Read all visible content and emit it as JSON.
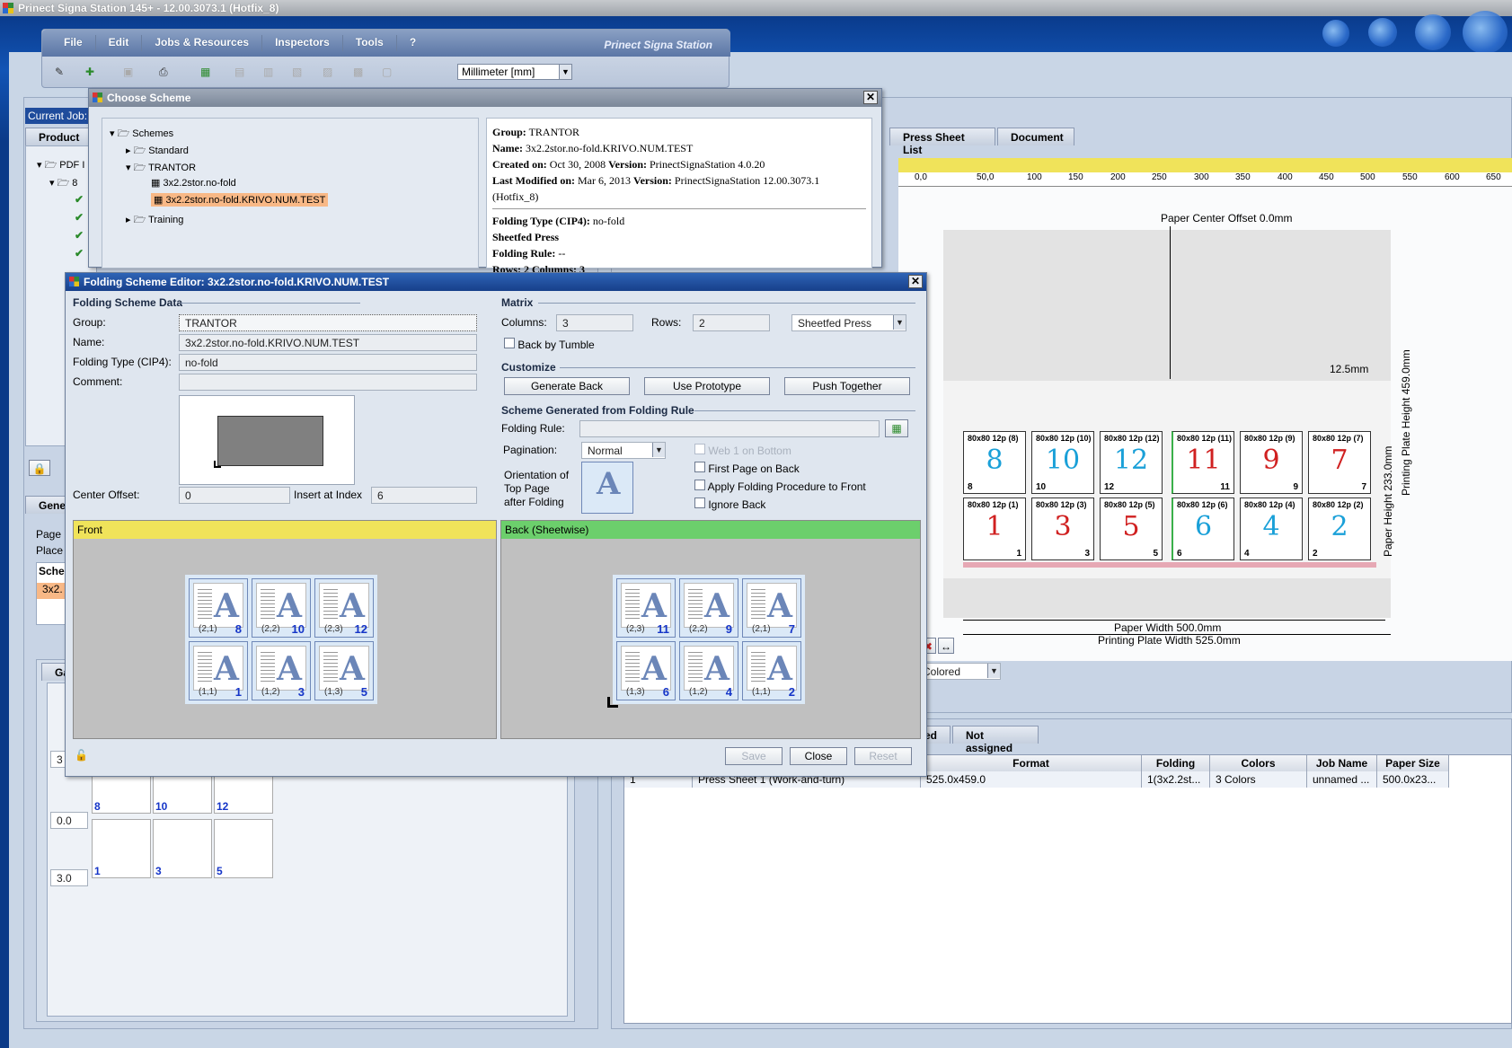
{
  "app": {
    "title": "Prinect Signa Station 145+  -  12.00.3073.1 (Hotfix_8)",
    "brand": "Prinect Signa Station"
  },
  "menu": [
    "File",
    "Edit",
    "Jobs & Resources",
    "Inspectors",
    "Tools",
    "?"
  ],
  "toolbar": {
    "unit": "Millimeter  [mm]"
  },
  "background": {
    "current_job_label": "Current Job:",
    "product_tab": "Product P",
    "pdf_node": "PDF I",
    "node_8": "8",
    "gene_tab": "Gene",
    "page_label": "Page",
    "place_label": "Place",
    "sche_header": "Sche",
    "sche_value": "3x2.",
    "ga_tab": "Ga",
    "val_3": "3",
    "val_00": "0.0",
    "val_30": "3.0",
    "thumb_nums": [
      "8",
      "10",
      "12",
      "1",
      "3",
      "5"
    ]
  },
  "right_area": {
    "tabs": [
      "Press Sheet List",
      "Document"
    ],
    "ruler_ticks": [
      "0,0",
      "50,0",
      "100",
      "150",
      "200",
      "250",
      "300",
      "350",
      "400",
      "450",
      "500",
      "550",
      "600",
      "650"
    ],
    "paper_center_offset": "Paper Center Offset 0.0mm",
    "margin_label": "12.5mm",
    "paper_height": "Paper Height 233.0mm",
    "plate_height": "Printing Plate Height 459.0mm",
    "paper_width": "Paper Width 500.0mm",
    "plate_width": "Printing Plate Width 525.0mm",
    "colors_select": "Colored",
    "sheet_cells": [
      {
        "hd": "80x80 12p (8)",
        "big": "8",
        "sm": "8",
        "color": "#1aa0d8"
      },
      {
        "hd": "80x80 12p (10)",
        "big": "10",
        "sm": "10",
        "color": "#1aa0d8"
      },
      {
        "hd": "80x80 12p (12)",
        "big": "12",
        "sm": "12",
        "color": "#1aa0d8"
      },
      {
        "hd": "80x80 12p (11)",
        "big": "11",
        "sm": "11",
        "color": "#d02020"
      },
      {
        "hd": "80x80 12p (9)",
        "big": "9",
        "sm": "9",
        "color": "#d02020"
      },
      {
        "hd": "80x80 12p (7)",
        "big": "7",
        "sm": "7",
        "color": "#d02020"
      },
      {
        "hd": "80x80 12p (1)",
        "big": "1",
        "sm": "1",
        "color": "#d02020"
      },
      {
        "hd": "80x80 12p (3)",
        "big": "3",
        "sm": "3",
        "color": "#d02020"
      },
      {
        "hd": "80x80 12p (5)",
        "big": "5",
        "sm": "5",
        "color": "#d02020"
      },
      {
        "hd": "80x80 12p (6)",
        "big": "6",
        "sm": "6",
        "color": "#1aa0d8"
      },
      {
        "hd": "80x80 12p (4)",
        "big": "4",
        "sm": "4",
        "color": "#1aa0d8"
      },
      {
        "hd": "80x80 12p (2)",
        "big": "2",
        "sm": "2",
        "color": "#1aa0d8"
      }
    ],
    "lower_tabs": [
      "ed",
      "Not assigned"
    ],
    "table": {
      "headers": [
        "Format",
        "Folding Sheet",
        "Colors",
        "Job Name",
        "Paper Size"
      ],
      "row": {
        "index": "1",
        "name": "Press Sheet 1 (Work-and-turn)",
        "format": "525.0x459.0",
        "folding": "1(3x2.2st...",
        "colors": "3 Colors",
        "job": "unnamed ...",
        "paper": "500.0x23..."
      }
    }
  },
  "choose_scheme": {
    "title": "Choose Scheme",
    "tree": {
      "root": "Schemes",
      "standard": "Standard",
      "tranto": "TRANTOR",
      "item1": "3x2.2stor.no-fold",
      "item2": "3x2.2stor.no-fold.KRIVO.NUM.TEST",
      "training": "Training"
    },
    "info": {
      "group_k": "Group:",
      "group_v": "TRANTOR",
      "name_k": "Name:",
      "name_v": "3x2.2stor.no-fold.KRIVO.NUM.TEST",
      "created_k": "Created on:",
      "created_v": "Oct 30, 2008",
      "version_k": "Version:",
      "version_v": "PrinectSignaStation 4.0.20",
      "modified_k": "Last Modified on:",
      "modified_v": "Mar 6, 2013",
      "version2_v": "PrinectSignaStation 12.00.3073.1 (Hotfix_8)",
      "ftype_k": "Folding Type (CIP4):",
      "ftype_v": "no-fold",
      "sheetfed": "Sheetfed Press",
      "frule_k": "Folding Rule:",
      "frule_v": "--",
      "rows": "Rows: 2  Columns: 3"
    }
  },
  "editor": {
    "title": "Folding Scheme Editor: 3x2.2stor.no-fold.KRIVO.NUM.TEST",
    "data_section": "Folding Scheme Data",
    "group_label": "Group:",
    "group_value": "TRANTOR",
    "name_label": "Name:",
    "name_value": "3x2.2stor.no-fold.KRIVO.NUM.TEST",
    "ftype_label": "Folding Type (CIP4):",
    "ftype_value": "no-fold",
    "comment_label": "Comment:",
    "comment_value": "",
    "center_offset_label": "Center Offset:",
    "center_offset_value": "0",
    "insert_index_label": "Insert at Index",
    "insert_index_value": "6",
    "matrix_section": "Matrix",
    "columns_label": "Columns:",
    "columns_value": "3",
    "rows_label": "Rows:",
    "rows_value": "2",
    "press_type": "Sheetfed Press",
    "back_by_tumble": "Back by Tumble",
    "customize_section": "Customize",
    "generate_back": "Generate Back",
    "use_prototype": "Use Prototype",
    "push_together": "Push Together",
    "generated_section": "Scheme Generated from Folding Rule",
    "folding_rule_label": "Folding Rule:",
    "pagination_label": "Pagination:",
    "pagination_value": "Normal",
    "orientation_label_1": "Orientation of",
    "orientation_label_2": "Top Page",
    "orientation_label_3": "after Folding",
    "web1_bottom": "Web 1 on Bottom",
    "first_page_back": "First Page on Back",
    "apply_folding": "Apply Folding Procedure to Front",
    "ignore_back": "Ignore Back",
    "front_label": "Front",
    "back_label": "Back (Sheetwise)",
    "front_tiles": [
      {
        "pos": "(2,1)",
        "num": "8"
      },
      {
        "pos": "(2,2)",
        "num": "10"
      },
      {
        "pos": "(2,3)",
        "num": "12"
      },
      {
        "pos": "(1,1)",
        "num": "1"
      },
      {
        "pos": "(1,2)",
        "num": "3"
      },
      {
        "pos": "(1,3)",
        "num": "5"
      }
    ],
    "back_tiles": [
      {
        "pos": "(2,3)",
        "num": "11"
      },
      {
        "pos": "(2,2)",
        "num": "9"
      },
      {
        "pos": "(2,1)",
        "num": "7"
      },
      {
        "pos": "(1,3)",
        "num": "6"
      },
      {
        "pos": "(1,2)",
        "num": "4"
      },
      {
        "pos": "(1,1)",
        "num": "2"
      }
    ],
    "save": "Save",
    "close": "Close",
    "reset": "Reset"
  }
}
